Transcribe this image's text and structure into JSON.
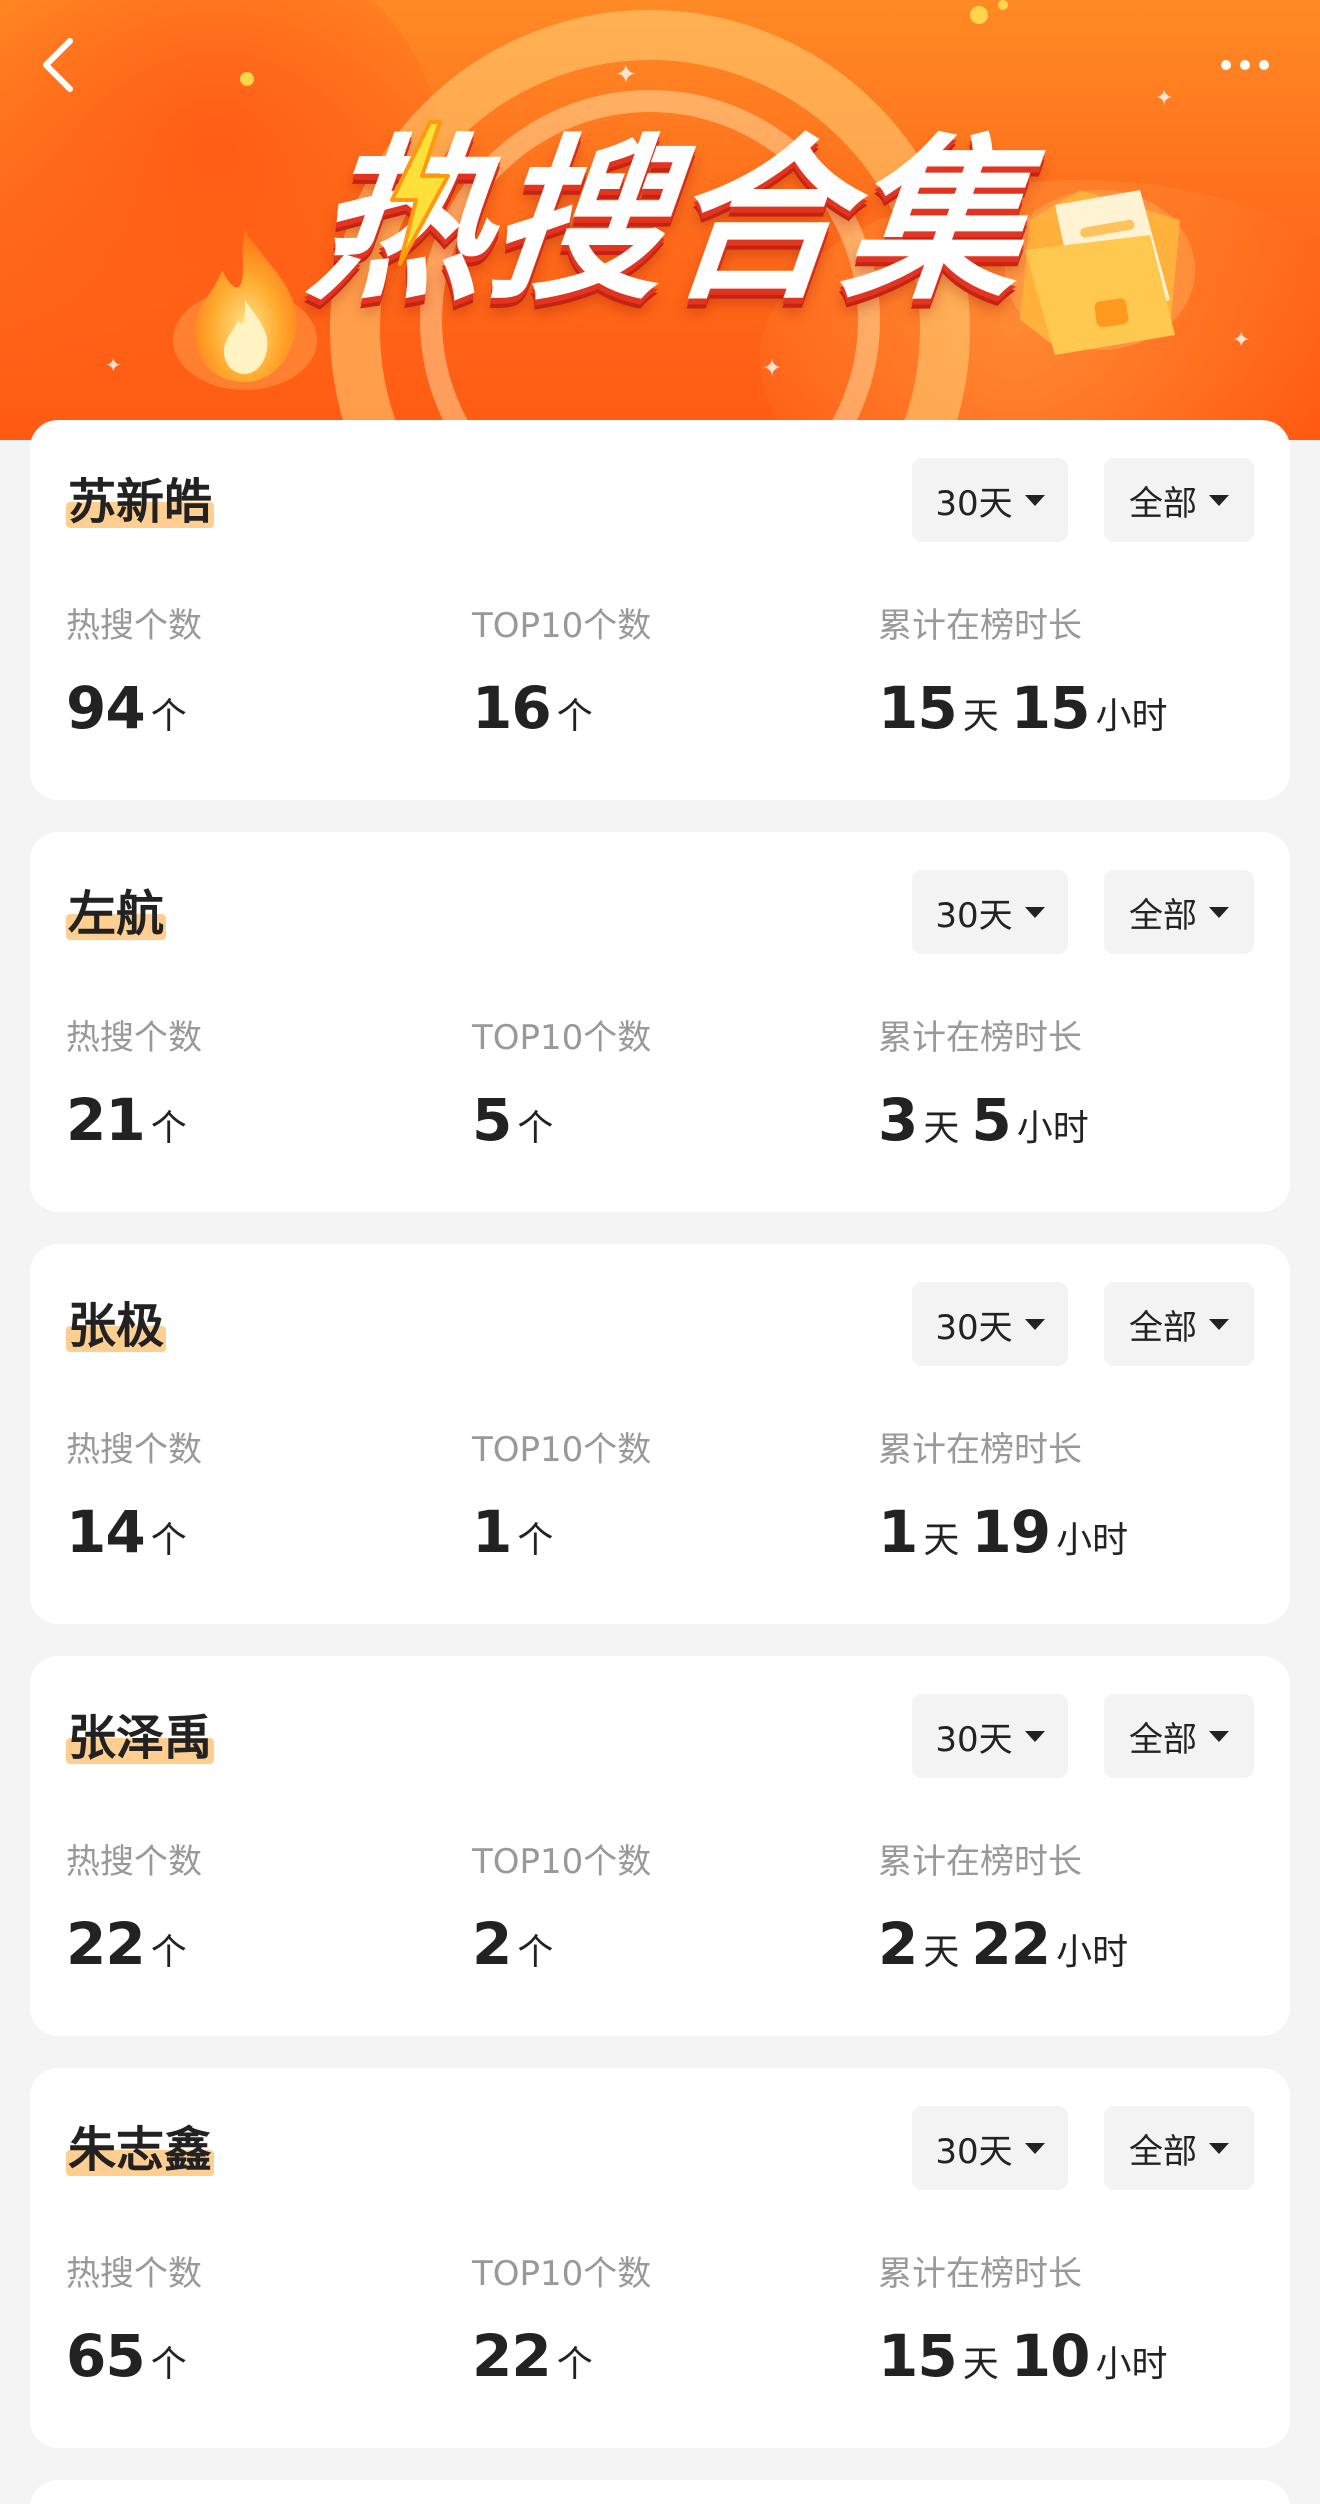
{
  "header": {
    "title": "热搜合集",
    "back_icon": "chevron-left-icon",
    "more_icon": "more-dots-icon"
  },
  "labels": {
    "hot_count": "热搜个数",
    "top10_count": "TOP10个数",
    "duration": "累计在榜时长",
    "unit_count": "个",
    "unit_day": "天",
    "unit_hour": "小时"
  },
  "colors": {
    "banner": "#ff6a1a",
    "name_highlight": "#ffcf91",
    "card_bg": "#ffffff",
    "page_bg": "#f4f4f4"
  },
  "cards": [
    {
      "name": "苏新皓",
      "period": "30天",
      "scope": "全部",
      "hot_count": "94",
      "top10_count": "16",
      "days": "15",
      "hours": "15"
    },
    {
      "name": "左航",
      "period": "30天",
      "scope": "全部",
      "hot_count": "21",
      "top10_count": "5",
      "days": "3",
      "hours": "5"
    },
    {
      "name": "张极",
      "period": "30天",
      "scope": "全部",
      "hot_count": "14",
      "top10_count": "1",
      "days": "1",
      "hours": "19"
    },
    {
      "name": "张泽禹",
      "period": "30天",
      "scope": "全部",
      "hot_count": "22",
      "top10_count": "2",
      "days": "2",
      "hours": "22"
    },
    {
      "name": "朱志鑫",
      "period": "30天",
      "scope": "全部",
      "hot_count": "65",
      "top10_count": "22",
      "days": "15",
      "hours": "10"
    }
  ]
}
